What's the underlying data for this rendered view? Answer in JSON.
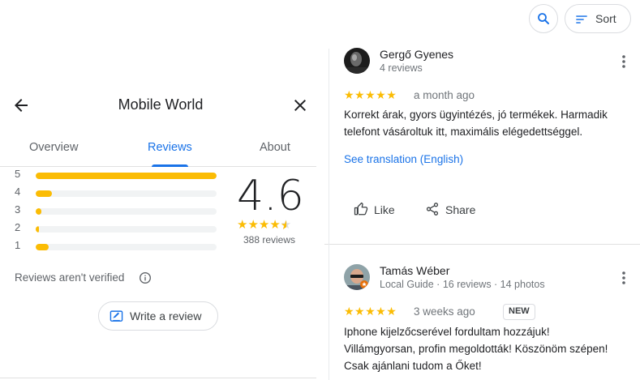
{
  "place": {
    "title": "Mobile World"
  },
  "tabs": {
    "overview": "Overview",
    "reviews": "Reviews",
    "about": "About"
  },
  "summary": {
    "rating": "4.6",
    "review_count": "388 reviews",
    "distribution": [
      {
        "stars": "5",
        "fraction": 1.0
      },
      {
        "stars": "4",
        "fraction": 0.09
      },
      {
        "stars": "3",
        "fraction": 0.03
      },
      {
        "stars": "2",
        "fraction": 0.02
      },
      {
        "stars": "1",
        "fraction": 0.07
      }
    ],
    "not_verified": "Reviews aren't verified",
    "write_review": "Write a review"
  },
  "toolbar": {
    "sort_label": "Sort"
  },
  "reviews": [
    {
      "name": "Gergő Gyenes",
      "meta": "4 reviews",
      "stars": "★★★★★",
      "date": "a month ago",
      "text": "Korrekt árak, gyors ügyintézés, jó termékek. Harmadik telefont vásároltuk itt, maximális elégedettséggel.",
      "translate": "See translation (English)",
      "like": "Like",
      "share": "Share"
    },
    {
      "name": "Tamás Wéber",
      "meta": "Local Guide · 16 reviews · 14 photos",
      "stars": "★★★★★",
      "date": "3 weeks ago",
      "badge": "NEW",
      "text_lines": [
        "Iphone kijelzőcserével fordultam hozzájuk!",
        "Villámgyorsan, profin megoldották! Köszönöm szépen!",
        "Csak ajánlani tudom a Őket!"
      ]
    }
  ],
  "colors": {
    "accent": "#1a73e8",
    "star": "#fbbc04"
  }
}
